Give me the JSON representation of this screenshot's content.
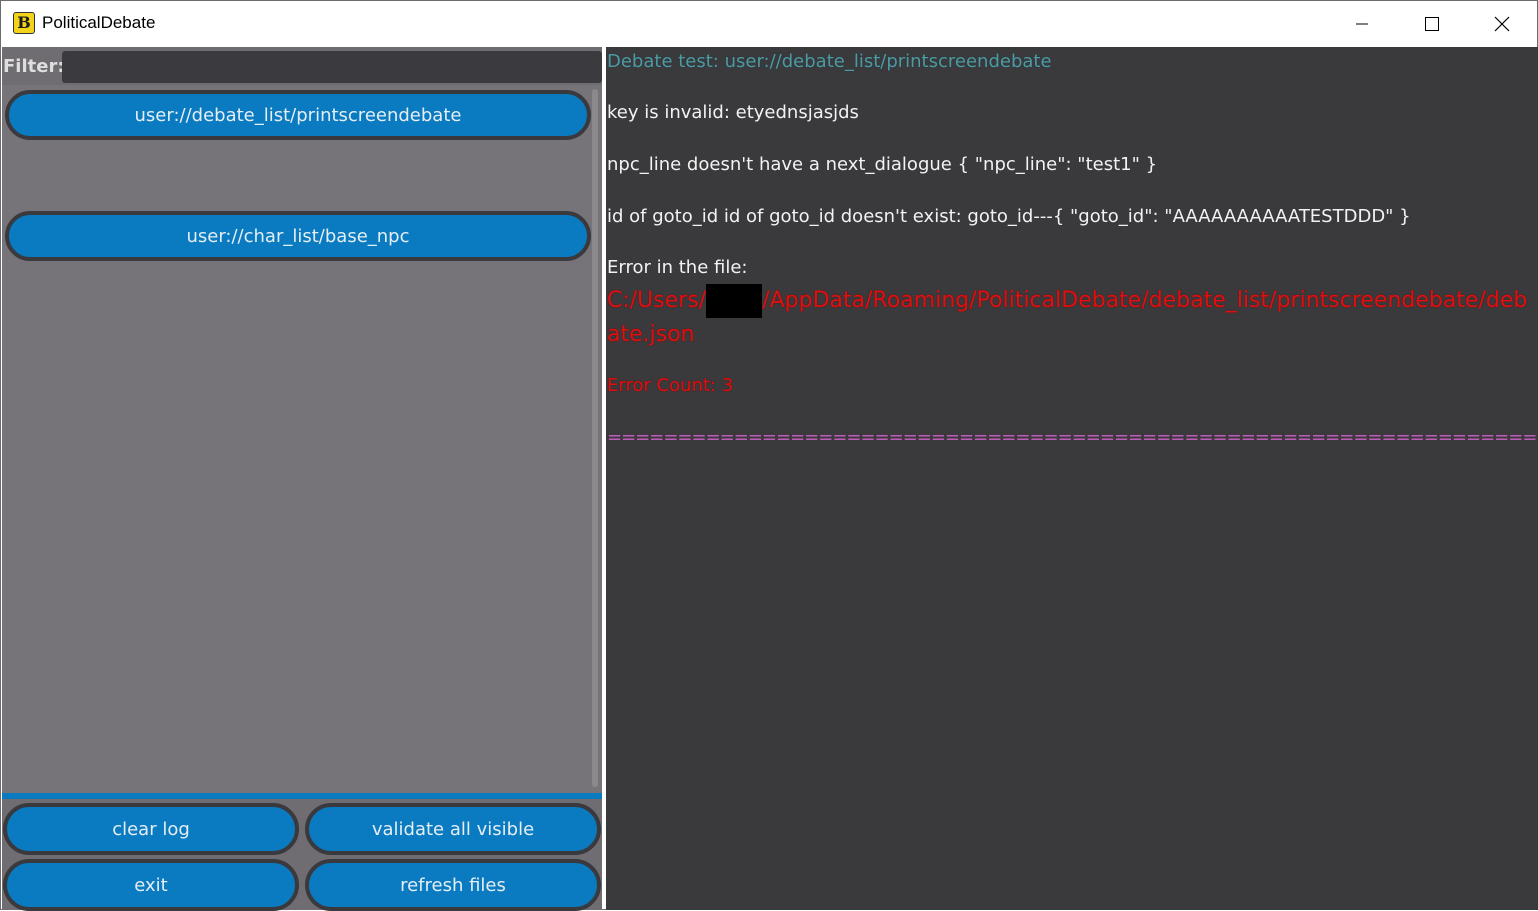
{
  "window": {
    "title": "PoliticalDebate",
    "icon_glyph": "B"
  },
  "filter": {
    "label": "Filter:",
    "value": "",
    "placeholder": ""
  },
  "files": [
    {
      "label": "user://debate_list/printscreendebate"
    },
    {
      "label": "user://char_list/base_npc"
    }
  ],
  "actions": {
    "clear_log": "clear log",
    "validate_all": "validate all visible",
    "exit": "exit",
    "refresh_files": "refresh files"
  },
  "log": {
    "header": "Debate test: user://debate_list/printscreendebate",
    "lines": [
      "key is invalid:  etyednsjasjds",
      "npc_line doesn't have a next_dialogue { \"npc_line\": \"test1\" }",
      "id of goto_id id of goto_id doesn't exist: goto_id---{ \"goto_id\": \"AAAAAAAAAATESTDDD\" }",
      "Error in the file:"
    ],
    "error_path_prefix": "C:/Users/",
    "error_path_suffix": "/AppData/Roaming/PoliticalDebate/debate_list/printscreendebate/debate.json",
    "error_count": "Error Count: 3",
    "separator": "====================================================================="
  },
  "colors": {
    "accent": "#0a7bc0",
    "error": "#e01010",
    "header": "#4e9aa2",
    "separator": "#c05bbd",
    "log_bg": "#3a393c",
    "panel_bg": "#767478"
  }
}
